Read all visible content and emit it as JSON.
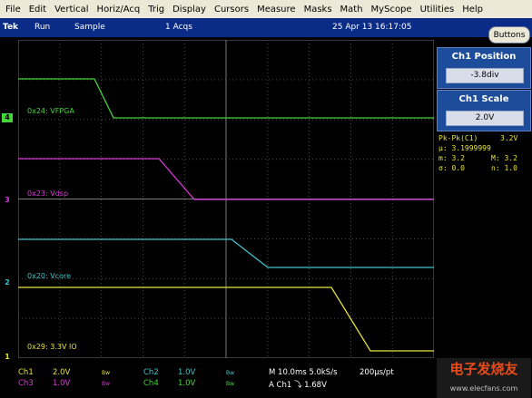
{
  "menu": [
    "File",
    "Edit",
    "Vertical",
    "Horiz/Acq",
    "Trig",
    "Display",
    "Cursors",
    "Measure",
    "Masks",
    "Math",
    "MyScope",
    "Utilities",
    "Help"
  ],
  "status": {
    "brand": "Tek",
    "run": "Run",
    "mode": "Sample",
    "acqs": "1 Acqs",
    "datetime": "25 Apr 13 16:17:05",
    "buttons": "Buttons"
  },
  "ch1_position": {
    "title": "Ch1 Position",
    "value": "-3.8div"
  },
  "ch1_scale": {
    "title": "Ch1 Scale",
    "value": "2.0V"
  },
  "measurement": {
    "title": "Pk-Pk(C1)",
    "value": "3.2V",
    "mu": "μ: 3.1999999",
    "m": "m: 3.2",
    "M": "M: 3.2",
    "sigma": "σ: 0.0",
    "n": "n: 1.0"
  },
  "traces": [
    {
      "label": "0x24: VFPGA",
      "color": "#45d43a",
      "marker": "4"
    },
    {
      "label": "0x23: Vdsp",
      "color": "#d93ad9",
      "marker": "3"
    },
    {
      "label": "0x20: Vcore",
      "color": "#40c4cc",
      "marker": "2"
    },
    {
      "label": "0x29: 3.3V IO",
      "color": "#e6e23a",
      "marker": "1"
    }
  ],
  "bottom": {
    "ch1": "Ch1",
    "ch1_v": "2.0V",
    "ch3": "Ch3",
    "ch3_v": "1.0V",
    "ch2": "Ch2",
    "ch2_v": "1.0V",
    "ch4": "Ch4",
    "ch4_v": "1.0V",
    "bw": "Bw",
    "timebase": "M 10.0ms 5.0kS/s",
    "pt": "200μs/pt",
    "trig": "A  Ch1  ⤵  1.68V"
  },
  "watermark": {
    "line1": "电子发烧友",
    "line2": "www.elecfans.com"
  }
}
